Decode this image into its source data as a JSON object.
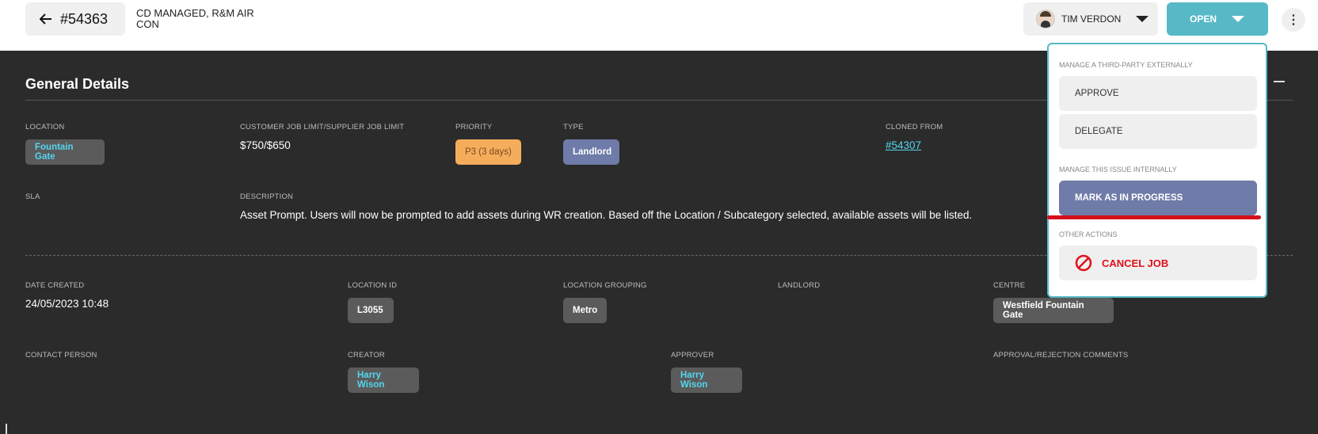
{
  "header": {
    "job_number": "#54363",
    "job_title": "CD MANAGED, R&M AIR CON",
    "assignee": "TIM VERDON",
    "status": "OPEN"
  },
  "general": {
    "title": "General Details",
    "location_label": "LOCATION",
    "location_value": "Fountain Gate",
    "limit_label": "CUSTOMER JOB LIMIT/SUPPLIER JOB LIMIT",
    "limit_value": "$750/$650",
    "priority_label": "PRIORITY",
    "priority_value": "P3 (3 days)",
    "type_label": "TYPE",
    "type_value": "Landlord",
    "cloned_label": "CLONED FROM",
    "cloned_value": "#54307",
    "sla_label": "SLA",
    "description_label": "DESCRIPTION",
    "description_value": "Asset Prompt. Users will now be prompted to add assets during WR creation. Based off the Location / Subcategory selected, available assets will be listed.",
    "date_created_label": "DATE CREATED",
    "date_created_value": "24/05/2023 10:48",
    "location_id_label": "LOCATION ID",
    "location_id_value": "L3055",
    "location_grouping_label": "LOCATION GROUPING",
    "location_grouping_value": "Metro",
    "landlord_label": "LANDLORD",
    "centre_label": "CENTRE",
    "centre_value": "Westfield Fountain Gate",
    "contact_label": "CONTACT PERSON",
    "creator_label": "CREATOR",
    "creator_value": "Harry Wison",
    "approver_label": "APPROVER",
    "approver_value": "Harry Wison",
    "comments_label": "APPROVAL/REJECTION COMMENTS"
  },
  "menu": {
    "external_heading": "MANAGE A THIRD-PARTY EXTERNALLY",
    "approve": "APPROVE",
    "delegate": "DELEGATE",
    "internal_heading": "MANAGE THIS ISSUE INTERNALLY",
    "mark_in_progress": "MARK AS IN PROGRESS",
    "other_heading": "OTHER ACTIONS",
    "cancel_job": "CANCEL JOB"
  },
  "colors": {
    "status_teal": "#56b9c5",
    "type_slate": "#6f7ba8",
    "priority_orange": "#f6ad5b",
    "link_cyan": "#53d6ee",
    "cancel_red": "#e0101a"
  }
}
